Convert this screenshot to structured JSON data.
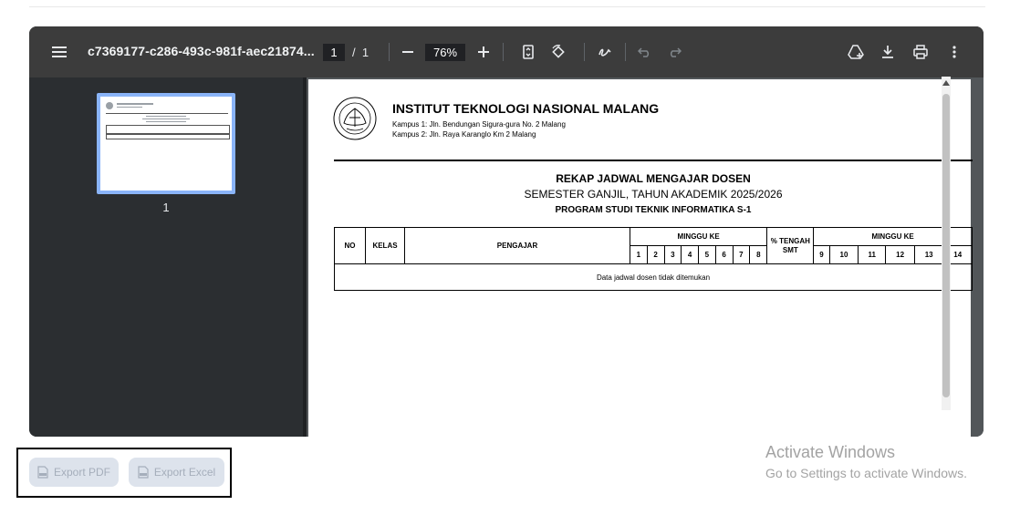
{
  "viewer": {
    "file_title": "c7369177-c286-493c-981f-aec21874...",
    "current_page": "1",
    "page_separator": "/",
    "total_pages": "1",
    "zoom": "76%",
    "icons": [
      "menu-icon",
      "zoom-out-icon",
      "zoom-in-icon",
      "fit-page-icon",
      "rotate-icon",
      "annotate-icon",
      "undo-icon",
      "redo-icon",
      "drive-add-icon",
      "download-icon",
      "print-icon",
      "more-vert-icon"
    ]
  },
  "sidebar": {
    "thumbnail_label": "1"
  },
  "document": {
    "institution": "INSTITUT TEKNOLOGI NASIONAL MALANG",
    "campus1": "Kampus 1: Jln. Bendungan Sigura-gura No. 2 Malang",
    "campus2": "Kampus 2: Jln. Raya Karanglo Km 2 Malang",
    "title": "REKAP JADWAL MENGAJAR DOSEN",
    "semester": "SEMESTER GANJIL, TAHUN AKADEMIK 2025/2026",
    "program": "PROGRAM STUDI TEKNIK INFORMATIKA S-1",
    "table": {
      "col_no": "NO",
      "col_kelas": "KELAS",
      "col_pengajar": "PENGAJAR",
      "col_minggu_1": "MINGGU KE",
      "col_tengah": "% TENGAH SMT",
      "col_minggu_2": "MINGGU KE",
      "weeks_first": [
        "1",
        "2",
        "3",
        "4",
        "5",
        "6",
        "7",
        "8"
      ],
      "weeks_second": [
        "9",
        "10",
        "11",
        "12",
        "13",
        "14"
      ],
      "empty_message": "Data jadwal dosen tidak ditemukan"
    }
  },
  "actions": {
    "export_pdf": "Export PDF",
    "export_excel": "Export Excel"
  },
  "watermark": {
    "line1": "Activate Windows",
    "line2": "Go to Settings to activate Windows."
  },
  "colors": {
    "toolbar_bg": "#3c3c3c",
    "thumb_highlight": "#8ab4f8",
    "button_bg": "#dde3ec"
  }
}
